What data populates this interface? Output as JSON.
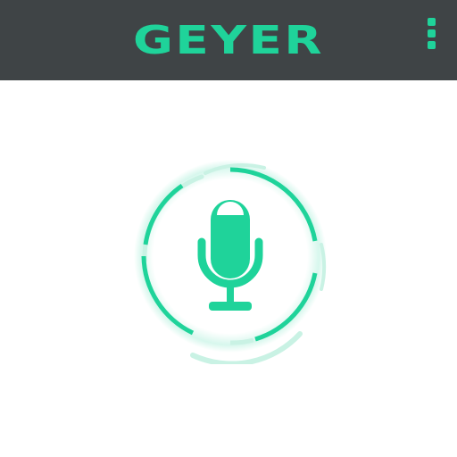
{
  "header": {
    "brand_name": "GEYER",
    "menu_icon": "more-vertical-icon"
  },
  "main": {
    "mic_icon": "microphone-icon",
    "progress_ring_icon": "progress-ring-icon"
  },
  "colors": {
    "topbar_background": "#3f4446",
    "accent": "#1fd39a",
    "accent_light": "#c9f2e4",
    "background": "#ffffff"
  }
}
